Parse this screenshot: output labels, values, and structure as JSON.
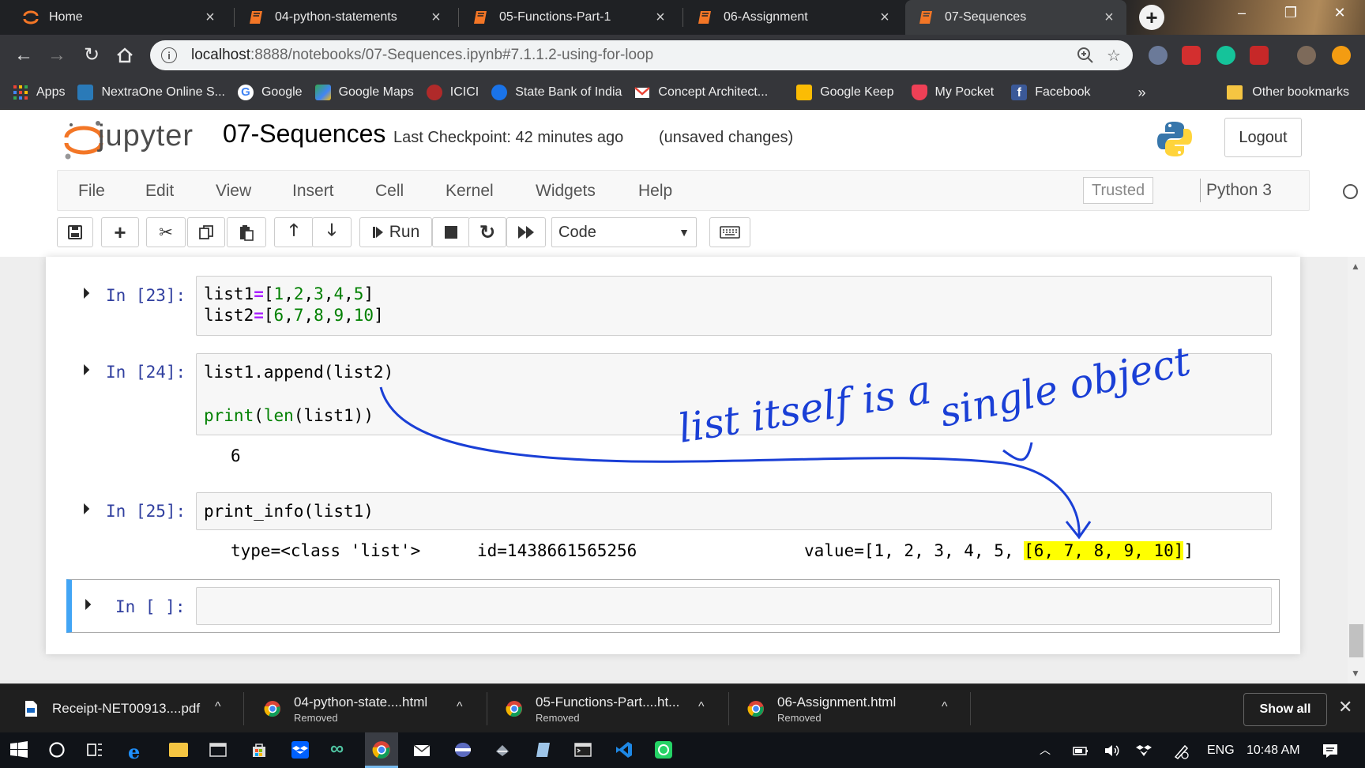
{
  "browser": {
    "tabs": [
      {
        "title": "Home",
        "icon": "jupyter-icon",
        "active": false
      },
      {
        "title": "04-python-statements",
        "icon": "notebook-icon",
        "active": false
      },
      {
        "title": "05-Functions-Part-1",
        "icon": "notebook-icon",
        "active": false
      },
      {
        "title": "06-Assignment",
        "icon": "notebook-icon",
        "active": false
      },
      {
        "title": "07-Sequences",
        "icon": "notebook-icon",
        "active": true
      }
    ],
    "new_tab": "+",
    "url_host": "localhost",
    "url_rest": ":8888/notebooks/07-Sequences.ipynb#7.1.1.2-using-for-loop",
    "bookmarks": [
      {
        "label": "Apps",
        "icon": "apps-grid-icon",
        "color": "#4285f4"
      },
      {
        "label": "NextraOne Online S...",
        "icon": "nextraone-icon",
        "color": "#2a7ab8"
      },
      {
        "label": "Google",
        "icon": "google-icon",
        "color": "#ffffff"
      },
      {
        "label": "Google Maps",
        "icon": "maps-icon",
        "color": "#34a853"
      },
      {
        "label": "ICICI",
        "icon": "icici-icon",
        "color": "#b02a2a"
      },
      {
        "label": "State Bank of India",
        "icon": "sbi-icon",
        "color": "#1a73e8"
      },
      {
        "label": "Concept Architect...",
        "icon": "gmail-icon",
        "color": "#ea4335"
      },
      {
        "label": "Google Keep",
        "icon": "keep-icon",
        "color": "#fbbc04"
      },
      {
        "label": "My Pocket",
        "icon": "pocket-icon",
        "color": "#ef4056"
      },
      {
        "label": "Facebook",
        "icon": "facebook-icon",
        "color": "#3b5998"
      }
    ],
    "bookmarks_more": "»",
    "other_bookmarks": "Other bookmarks"
  },
  "jupyter": {
    "wordmark": "jupyter",
    "notebook_name": "07-Sequences",
    "checkpoint": "Last Checkpoint: 42 minutes ago",
    "unsaved": "(unsaved changes)",
    "logout": "Logout",
    "menus": [
      "File",
      "Edit",
      "View",
      "Insert",
      "Cell",
      "Kernel",
      "Widgets",
      "Help"
    ],
    "trusted": "Trusted",
    "kernel": "Python 3",
    "run_label": "Run",
    "cell_type": "Code"
  },
  "cells": [
    {
      "prompt": "In [23]:",
      "code_lines": [
        "list1=[1,2,3,4,5]",
        "list2=[6,7,8,9,10]"
      ]
    },
    {
      "prompt": "In [24]:",
      "code_lines": [
        "list1.append(list2)",
        "",
        "print(len(list1))"
      ],
      "output": "6"
    },
    {
      "prompt": "In [25]:",
      "code_lines": [
        "print_info(list1)"
      ],
      "output_type": "type=<class 'list'>",
      "output_id": "id=1438661565256",
      "output_value_prefix": "value=[1, 2, 3, 4, 5, ",
      "output_value_highlight": "[6, 7, 8, 9, 10]",
      "output_value_suffix": "]"
    },
    {
      "prompt": "In [ ]:",
      "code_lines": [
        ""
      ]
    }
  ],
  "annotation": {
    "line1": "list itself is a",
    "line2": "single object",
    "ink_color": "#1a3fd6",
    "highlight_color": "#ffff00"
  },
  "downloads": [
    {
      "name": "Receipt-NET00913....pdf",
      "status": "",
      "icon": "pdf-icon"
    },
    {
      "name": "04-python-state....html",
      "status": "Removed",
      "icon": "chrome-icon"
    },
    {
      "name": "05-Functions-Part....ht...",
      "status": "Removed",
      "icon": "chrome-icon"
    },
    {
      "name": "06-Assignment.html",
      "status": "Removed",
      "icon": "chrome-icon"
    }
  ],
  "show_all": "Show all",
  "taskbar": {
    "language": "ENG",
    "time": "10:48 AM"
  }
}
